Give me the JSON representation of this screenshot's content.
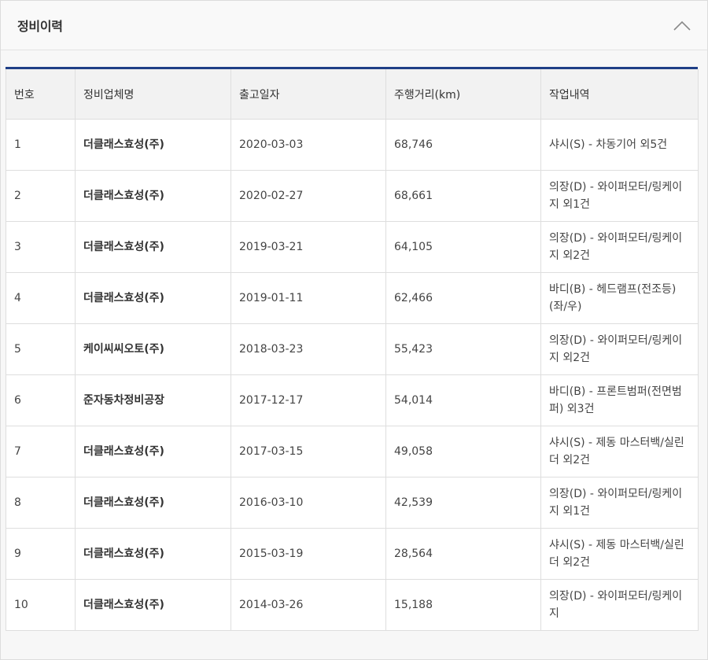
{
  "panel": {
    "title": "정비이력",
    "collapse_icon": "chevron-up-icon"
  },
  "colors": {
    "accent": "#1f3f86",
    "header_bg": "#f2f2f2",
    "border": "#dedede"
  },
  "table": {
    "headers": {
      "no": "번호",
      "company": "정비업체명",
      "date": "출고일자",
      "mileage": "주행거리(km)",
      "work": "작업내역"
    },
    "rows": [
      {
        "no": "1",
        "company": "더클래스효성(주)",
        "date": "2020-03-03",
        "mileage": "68,746",
        "work": "샤시(S) - 차동기어 외5건"
      },
      {
        "no": "2",
        "company": "더클래스효성(주)",
        "date": "2020-02-27",
        "mileage": "68,661",
        "work": "의장(D) - 와이퍼모터/링케이지 외1건"
      },
      {
        "no": "3",
        "company": "더클래스효성(주)",
        "date": "2019-03-21",
        "mileage": "64,105",
        "work": "의장(D) - 와이퍼모터/링케이지 외2건"
      },
      {
        "no": "4",
        "company": "더클래스효성(주)",
        "date": "2019-01-11",
        "mileage": "62,466",
        "work": "바디(B) - 헤드램프(전조등)(좌/우)"
      },
      {
        "no": "5",
        "company": "케이씨씨오토(주)",
        "date": "2018-03-23",
        "mileage": "55,423",
        "work": "의장(D) - 와이퍼모터/링케이지 외2건"
      },
      {
        "no": "6",
        "company": "준자동차정비공장",
        "date": "2017-12-17",
        "mileage": "54,014",
        "work": "바디(B) - 프론트범퍼(전면범퍼) 외3건"
      },
      {
        "no": "7",
        "company": "더클래스효성(주)",
        "date": "2017-03-15",
        "mileage": "49,058",
        "work": "샤시(S) - 제동 마스터백/실린더 외2건"
      },
      {
        "no": "8",
        "company": "더클래스효성(주)",
        "date": "2016-03-10",
        "mileage": "42,539",
        "work": "의장(D) - 와이퍼모터/링케이지 외1건"
      },
      {
        "no": "9",
        "company": "더클래스효성(주)",
        "date": "2015-03-19",
        "mileage": "28,564",
        "work": "샤시(S) - 제동 마스터백/실린더 외2건"
      },
      {
        "no": "10",
        "company": "더클래스효성(주)",
        "date": "2014-03-26",
        "mileage": "15,188",
        "work": "의장(D) - 와이퍼모터/링케이지"
      }
    ]
  }
}
